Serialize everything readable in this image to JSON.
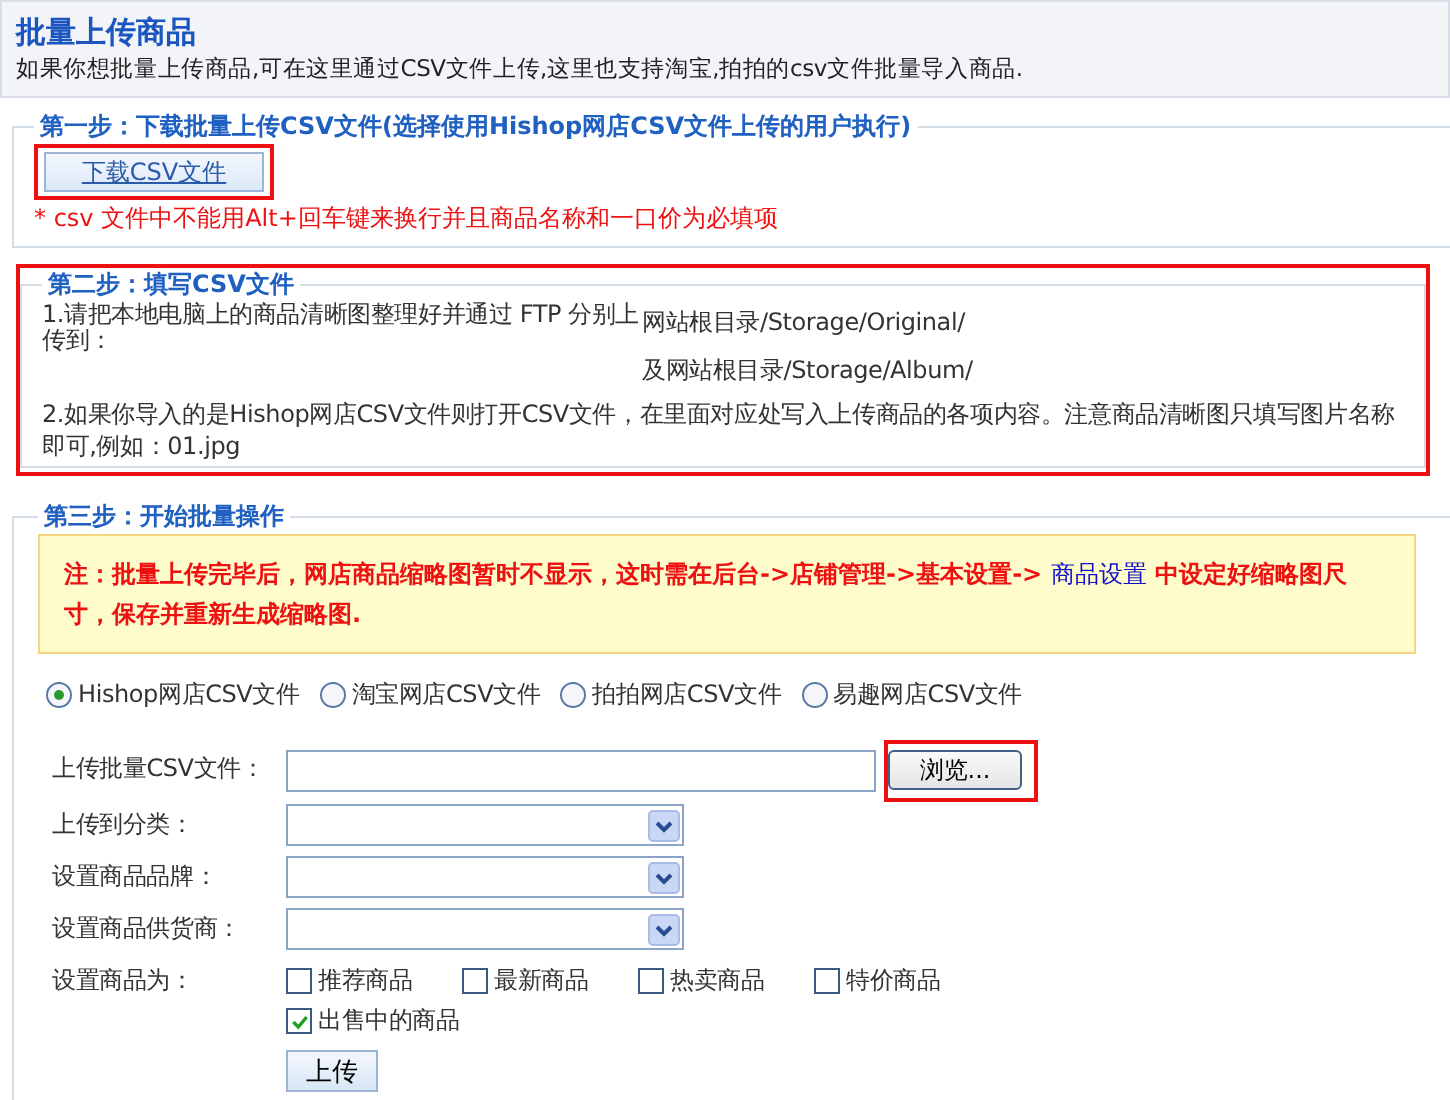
{
  "header": {
    "title": "批量上传商品",
    "description": "如果你想批量上传商品,可在这里通过CSV文件上传,这里也支持淘宝,拍拍的csv文件批量导入商品."
  },
  "step1": {
    "legend": "第一步：下载批量上传CSV文件(选择使用Hishop网店CSV文件上传的用户执行)",
    "download_button": {
      "label": "下载CSV文件",
      "highlighted": true
    },
    "note": "* csv 文件中不能用Alt+回车键来换行并且商品名称和一口价为必填项"
  },
  "step2": {
    "legend": "第二步：填写CSV文件",
    "highlighted": true,
    "instruction_1": "1.请把本地电脑上的商品清晰图整理好并通过  FTP 分别上传到：",
    "paths": [
      "网站根目录/Storage/Original/",
      "及网站根目录/Storage/Album/"
    ],
    "instruction_2": "2.如果你导入的是Hishop网店CSV文件则打开CSV文件，在里面对应处写入上传商品的各项内容。注意商品清晰图只填写图片名称即可,例如：01.jpg"
  },
  "step3": {
    "legend": "第三步：开始批量操作",
    "notice": {
      "before": "注：批量上传完毕后，网店商品缩略图暂时不显示，这时需在后台->店铺管理->基本设置->",
      "link": "商品设置",
      "after": "中设定好缩略图尺寸，保存并重新生成缩略图."
    },
    "file_types": [
      {
        "label": "Hishop网店CSV文件",
        "selected": true
      },
      {
        "label": "淘宝网店CSV文件",
        "selected": false
      },
      {
        "label": "拍拍网店CSV文件",
        "selected": false
      },
      {
        "label": "易趣网店CSV文件",
        "selected": false
      }
    ],
    "form": [
      {
        "kind": "file",
        "label": "上传批量CSV文件：",
        "browse_button": {
          "label": "浏览...",
          "highlighted": true
        }
      },
      {
        "kind": "select",
        "label": "上传到分类："
      },
      {
        "kind": "select",
        "label": "设置商品品牌："
      },
      {
        "kind": "select",
        "label": "设置商品供货商："
      },
      {
        "kind": "checkboxes",
        "label": "设置商品为：",
        "options": [
          {
            "label": "推荐商品",
            "checked": false
          },
          {
            "label": "最新商品",
            "checked": false
          },
          {
            "label": "热卖商品",
            "checked": false
          },
          {
            "label": "特价商品",
            "checked": false
          },
          {
            "label": "出售中的商品",
            "checked": true
          }
        ]
      }
    ],
    "upload_button": "上传"
  }
}
